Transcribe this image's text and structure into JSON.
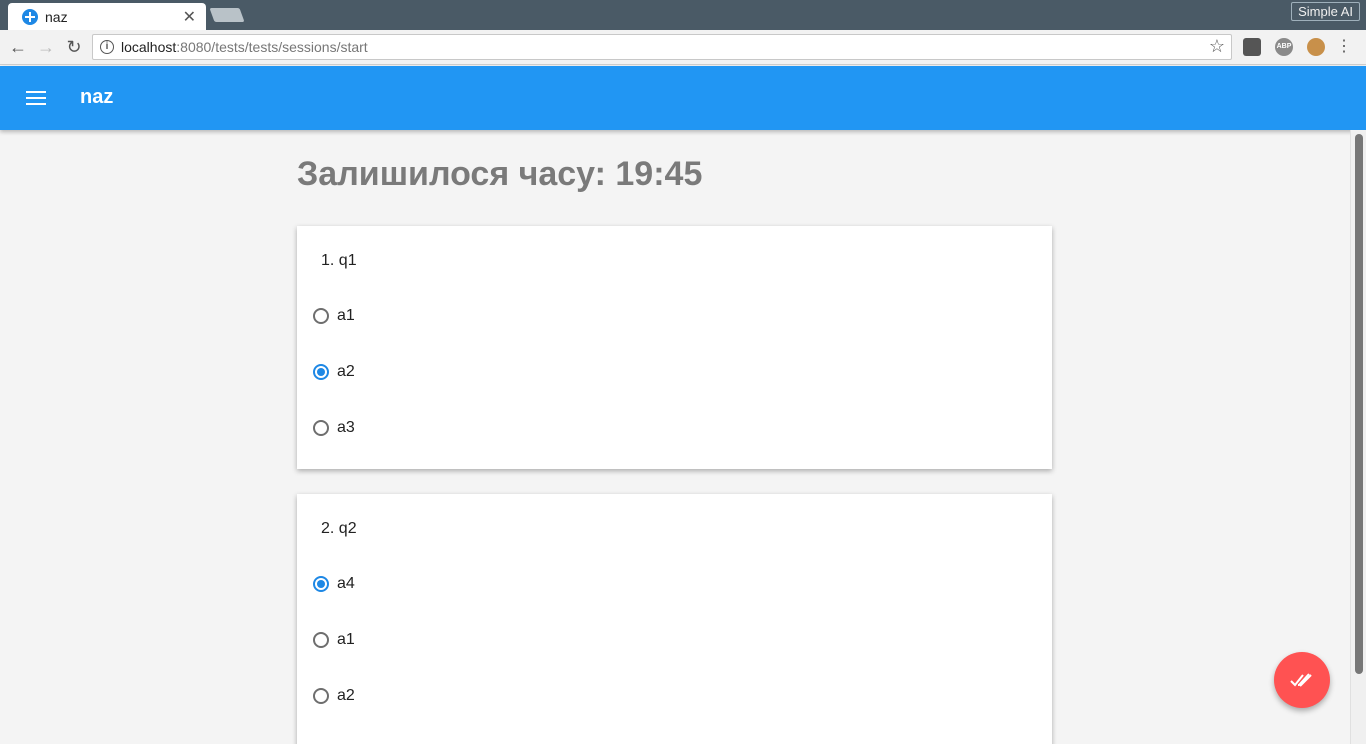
{
  "browser": {
    "tab_title": "naz",
    "tab_close": "✕",
    "profile_label": "Simple AI",
    "url_host": "localhost",
    "url_rest": ":8080/tests/tests/sessions/start",
    "ext_abp": "ABP"
  },
  "app": {
    "title": "naz"
  },
  "timer": {
    "text": "Залишилося часу: 19:45"
  },
  "questions": [
    {
      "title": "1. q1",
      "options": [
        {
          "label": "a1",
          "checked": false
        },
        {
          "label": "a2",
          "checked": true
        },
        {
          "label": "a3",
          "checked": false
        }
      ]
    },
    {
      "title": "2. q2",
      "options": [
        {
          "label": "a4",
          "checked": true
        },
        {
          "label": "a1",
          "checked": false
        },
        {
          "label": "a2",
          "checked": false
        }
      ]
    }
  ],
  "colors": {
    "app_bar": "#2196f3",
    "fab": "#ff5252",
    "radio_checked": "#1e88e5"
  }
}
